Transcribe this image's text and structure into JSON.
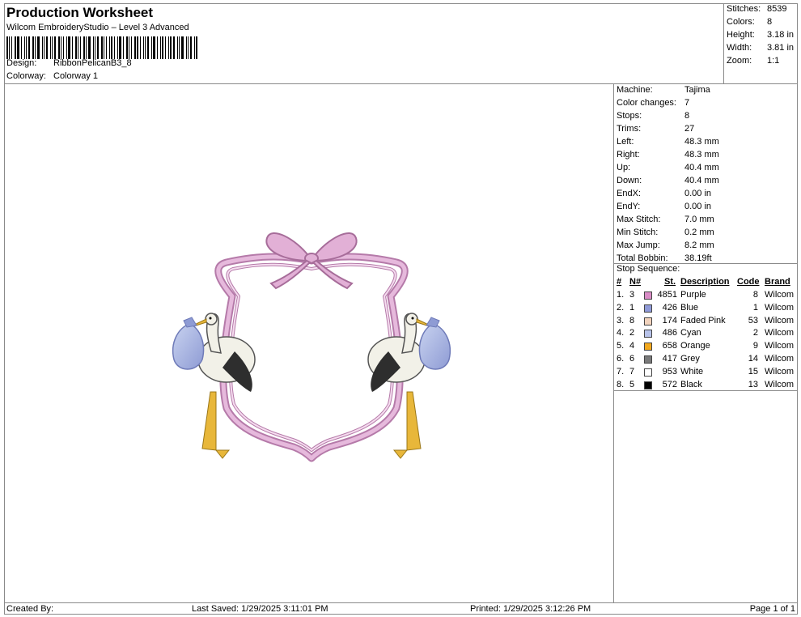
{
  "header": {
    "title": "Production Worksheet",
    "subtitle": "Wilcom EmbroideryStudio – Level 3 Advanced",
    "design_label": "Design:",
    "design_value": "RibbonPelicanB3_8",
    "colorway_label": "Colorway:",
    "colorway_value": "Colorway 1"
  },
  "summary": [
    {
      "label": "Stitches:",
      "value": "8539"
    },
    {
      "label": "Colors:",
      "value": "8"
    },
    {
      "label": "Height:",
      "value": "3.18 in"
    },
    {
      "label": "Width:",
      "value": "3.81 in"
    },
    {
      "label": "Zoom:",
      "value": "1:1"
    }
  ],
  "stats": [
    {
      "label": "Machine:",
      "value": "Tajima"
    },
    {
      "label": "Color changes:",
      "value": "7"
    },
    {
      "label": "Stops:",
      "value": "8"
    },
    {
      "label": "Trims:",
      "value": "27"
    },
    {
      "label": "Left:",
      "value": "48.3 mm"
    },
    {
      "label": "Right:",
      "value": "48.3 mm"
    },
    {
      "label": "Up:",
      "value": "40.4 mm"
    },
    {
      "label": "Down:",
      "value": "40.4 mm"
    },
    {
      "label": "EndX:",
      "value": "0.00 in"
    },
    {
      "label": "EndY:",
      "value": "0.00 in"
    },
    {
      "label": "Max Stitch:",
      "value": "7.0 mm"
    },
    {
      "label": "Min Stitch:",
      "value": "0.2 mm"
    },
    {
      "label": "Max Jump:",
      "value": "8.2 mm"
    },
    {
      "label": "Total Bobbin:",
      "value": "38.19ft"
    }
  ],
  "stop_sequence": {
    "title": "Stop Sequence:",
    "headers": {
      "num": "#",
      "n": "N#",
      "st": "St.",
      "desc": "Description",
      "code": "Code",
      "brand": "Brand"
    },
    "rows": [
      {
        "num": "1.",
        "n": "3",
        "color": "#d98cc6",
        "st": "4851",
        "desc": "Purple",
        "code": "8",
        "brand": "Wilcom"
      },
      {
        "num": "2.",
        "n": "1",
        "color": "#8f9ad8",
        "st": "426",
        "desc": "Blue",
        "code": "1",
        "brand": "Wilcom"
      },
      {
        "num": "3.",
        "n": "8",
        "color": "#f2d3bd",
        "st": "174",
        "desc": "Faded Pink",
        "code": "53",
        "brand": "Wilcom"
      },
      {
        "num": "4.",
        "n": "2",
        "color": "#b8c3ea",
        "st": "486",
        "desc": "Cyan",
        "code": "2",
        "brand": "Wilcom"
      },
      {
        "num": "5.",
        "n": "4",
        "color": "#f2a81d",
        "st": "658",
        "desc": "Orange",
        "code": "9",
        "brand": "Wilcom"
      },
      {
        "num": "6.",
        "n": "6",
        "color": "#7a7a7a",
        "st": "417",
        "desc": "Grey",
        "code": "14",
        "brand": "Wilcom"
      },
      {
        "num": "7.",
        "n": "7",
        "color": "#ffffff",
        "st": "953",
        "desc": "White",
        "code": "15",
        "brand": "Wilcom"
      },
      {
        "num": "8.",
        "n": "5",
        "color": "#000000",
        "st": "572",
        "desc": "Black",
        "code": "13",
        "brand": "Wilcom"
      }
    ]
  },
  "footer": {
    "created": "Created By:",
    "saved": "Last Saved: 1/29/2025 3:11:01 PM",
    "printed": "Printed: 1/29/2025 3:12:26 PM",
    "page": "Page 1 of 1"
  }
}
